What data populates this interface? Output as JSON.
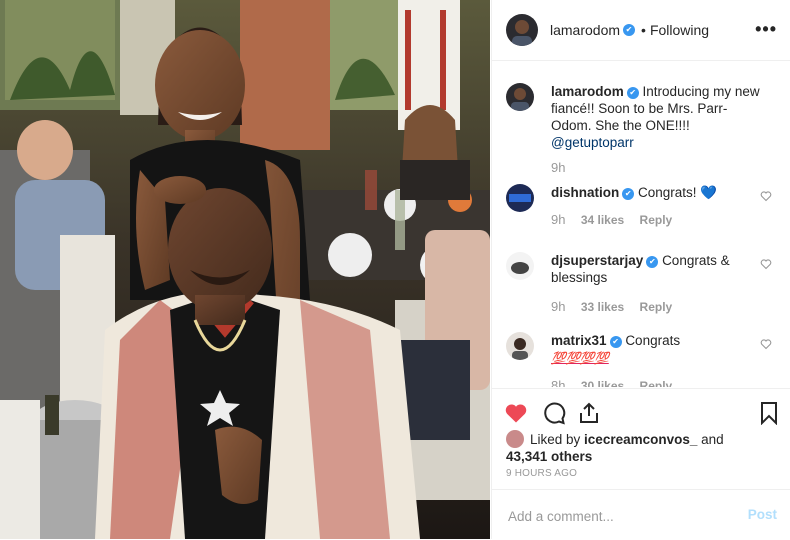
{
  "post": {
    "author": "lamarodom",
    "follow_status": "Following",
    "more_label": "•••"
  },
  "caption": {
    "username": "lamarodom",
    "text": "Introducing my new fiancé!! Soon to be Mrs. Parr-Odom. She the ONE!!!!",
    "mention": "@getuptoparr",
    "time": "9h"
  },
  "comments": [
    {
      "username": "dishnation",
      "text": "Congrats! ",
      "emoji": "💙",
      "time": "9h",
      "likes": "34 likes",
      "reply": "Reply"
    },
    {
      "username": "djsuperstarjay",
      "text": "Congrats & blessings",
      "time": "9h",
      "likes": "33 likes",
      "reply": "Reply"
    },
    {
      "username": "matrix31",
      "text": "Congrats",
      "emoji": "💯💯💯💯",
      "time": "8h",
      "likes": "30 likes",
      "reply": "Reply"
    }
  ],
  "likes": {
    "prefix": "Liked by ",
    "user": "icecreamconvos_",
    "middle": " and",
    "count": "43,341 others"
  },
  "time_ago": "9 HOURS AGO",
  "comment_box": {
    "placeholder": "Add a comment...",
    "post_label": "Post"
  },
  "colors": {
    "like_active": "#ed4956",
    "verified": "#3897f0",
    "post_disabled": "#b2dffc"
  }
}
